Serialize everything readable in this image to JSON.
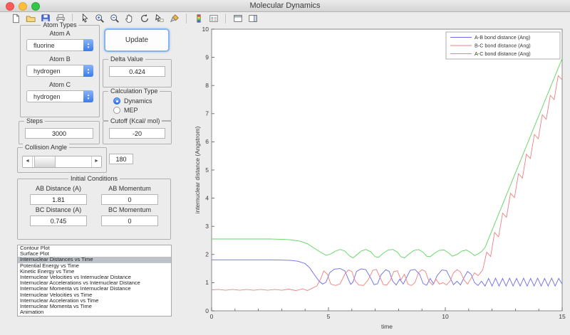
{
  "window": {
    "title": "Molecular Dynamics"
  },
  "colors": {
    "accent": "#3a7bf0",
    "selection": "#bdc3c9",
    "series_blue": "#6b6bee",
    "series_red": "#ef8080",
    "series_green": "#5fd45f"
  },
  "toolbar": {
    "groups": [
      [
        "new-figure",
        "open-file",
        "save-figure",
        "print-figure"
      ],
      [
        "edit-plot",
        "zoom-in",
        "zoom-out",
        "pan",
        "rotate-3d",
        "data-cursor",
        "brush-data"
      ],
      [
        "insert-colorbar",
        "insert-legend"
      ],
      [
        "hide-plot-tools",
        "show-plot-tools"
      ]
    ]
  },
  "panel": {
    "atom_types": {
      "title": "Atom Types",
      "atoms": [
        {
          "label": "Atom A",
          "value": "fluorine"
        },
        {
          "label": "Atom B",
          "value": "hydrogen"
        },
        {
          "label": "Atom C",
          "value": "hydrogen"
        }
      ]
    },
    "update_label": "Update",
    "delta": {
      "title": "Delta Value",
      "value": "0.424"
    },
    "calc": {
      "title": "Calculation Type",
      "options": [
        "Dynamics",
        "MEP"
      ],
      "selected": "Dynamics"
    },
    "steps": {
      "title": "Steps",
      "value": "3000"
    },
    "cutoff": {
      "title": "Cutoff (Kcal/ mol)",
      "value": "-20"
    },
    "collision": {
      "title": "Collision Angle",
      "value": "180"
    },
    "initial": {
      "title": "Initial Conditions",
      "fields": [
        {
          "label": "AB Distance (A)",
          "value": "1.81"
        },
        {
          "label": "AB Momentum",
          "value": "0"
        },
        {
          "label": "BC Distance (A)",
          "value": "0.745"
        },
        {
          "label": "BC Momentum",
          "value": "0"
        }
      ]
    },
    "plot_list": {
      "selected_index": 2,
      "items": [
        "Contour Plot",
        "Surface Plot",
        "Internuclear Distances vs Time",
        "Potential Energy vs Time",
        "Kinetic Energy vs Time",
        "Internuclear Velocities vs Internuclear Distance",
        "Internuclear Accelerations vs Internuclear Distance",
        "Internuclear Momenta vs Internuclear Distance",
        "Internuclear Velocities vs Time",
        "Internuclear Acceleration vs Time",
        "Internuclear Momenta vs Time",
        "Animation"
      ]
    }
  },
  "chart_data": {
    "type": "line",
    "title": "",
    "xlabel": "time",
    "ylabel": "internuclear distance (Angstrom)",
    "xlim": [
      0,
      15
    ],
    "ylim": [
      0,
      10
    ],
    "xticks": [
      0,
      5,
      10,
      15
    ],
    "yticks": [
      0,
      1,
      2,
      3,
      4,
      5,
      6,
      7,
      8,
      9,
      10
    ],
    "grid": false,
    "legend_position": "top-right",
    "series": [
      {
        "name": "A-B bond distance (Ang)",
        "color": "#6b6bee",
        "points": [
          [
            0,
            1.81
          ],
          [
            0.5,
            1.81
          ],
          [
            1,
            1.81
          ],
          [
            1.5,
            1.81
          ],
          [
            2,
            1.81
          ],
          [
            2.5,
            1.81
          ],
          [
            3,
            1.8
          ],
          [
            3.4,
            1.79
          ],
          [
            3.7,
            1.76
          ],
          [
            4,
            1.68
          ],
          [
            4.2,
            1.52
          ],
          [
            4.4,
            1.28
          ],
          [
            4.6,
            1.05
          ],
          [
            4.75,
            0.95
          ],
          [
            4.9,
            1.02
          ],
          [
            5.05,
            1.35
          ],
          [
            5.25,
            1.48
          ],
          [
            5.5,
            1.5
          ],
          [
            5.7,
            1.42
          ],
          [
            5.85,
            1.12
          ],
          [
            5.95,
            0.94
          ],
          [
            6.05,
            1.02
          ],
          [
            6.2,
            1.4
          ],
          [
            6.4,
            1.49
          ],
          [
            6.6,
            1.46
          ],
          [
            6.8,
            1.18
          ],
          [
            6.95,
            0.93
          ],
          [
            7.1,
            0.96
          ],
          [
            7.25,
            1.28
          ],
          [
            7.45,
            1.46
          ],
          [
            7.6,
            1.4
          ],
          [
            7.75,
            1.05
          ],
          [
            7.9,
            0.92
          ],
          [
            8.05,
            1.12
          ],
          [
            8.2,
            0.95
          ],
          [
            8.35,
            1.2
          ],
          [
            8.5,
            1.44
          ],
          [
            8.7,
            1.47
          ],
          [
            8.9,
            1.3
          ],
          [
            9.05,
            0.97
          ],
          [
            9.2,
            0.91
          ],
          [
            9.35,
            1.15
          ],
          [
            9.5,
            0.96
          ],
          [
            9.65,
            1.25
          ],
          [
            9.85,
            1.45
          ],
          [
            10.05,
            1.43
          ],
          [
            10.2,
            1.18
          ],
          [
            10.35,
            0.93
          ],
          [
            10.5,
            1.05
          ],
          [
            10.65,
            0.92
          ],
          [
            10.8,
            1.18
          ],
          [
            10.95,
            1.4
          ],
          [
            11.1,
            1.3
          ],
          [
            11.25,
            1
          ],
          [
            11.4,
            0.9
          ],
          [
            11.55,
            1.05
          ],
          [
            11.7,
            0.88
          ],
          [
            11.85,
            1.15
          ],
          [
            12,
            0.88
          ],
          [
            12.15,
            1.16
          ],
          [
            12.3,
            0.88
          ],
          [
            12.45,
            1.15
          ],
          [
            12.6,
            0.88
          ],
          [
            12.75,
            1.16
          ],
          [
            12.9,
            0.88
          ],
          [
            13.05,
            1.15
          ],
          [
            13.2,
            0.88
          ],
          [
            13.35,
            1.16
          ],
          [
            13.5,
            0.88
          ],
          [
            13.65,
            1.15
          ],
          [
            13.8,
            0.88
          ],
          [
            13.95,
            1.16
          ],
          [
            14.1,
            0.88
          ],
          [
            14.25,
            1.15
          ],
          [
            14.4,
            0.88
          ],
          [
            14.55,
            1.16
          ],
          [
            14.7,
            0.88
          ],
          [
            14.85,
            1.15
          ],
          [
            15,
            0.95
          ]
        ]
      },
      {
        "name": "B-C bond distance (Ang)",
        "color": "#ef8080",
        "points": [
          [
            0,
            0.745
          ],
          [
            0.3,
            0.76
          ],
          [
            0.6,
            0.73
          ],
          [
            0.9,
            0.76
          ],
          [
            1.2,
            0.73
          ],
          [
            1.5,
            0.76
          ],
          [
            1.8,
            0.73
          ],
          [
            2.1,
            0.76
          ],
          [
            2.4,
            0.73
          ],
          [
            2.7,
            0.76
          ],
          [
            3,
            0.73
          ],
          [
            3.3,
            0.77
          ],
          [
            3.6,
            0.72
          ],
          [
            3.9,
            0.78
          ],
          [
            4.1,
            0.72
          ],
          [
            4.3,
            0.8
          ],
          [
            4.5,
            0.88
          ],
          [
            4.65,
            1.1
          ],
          [
            4.8,
            1.42
          ],
          [
            4.95,
            1.3
          ],
          [
            5.1,
            0.95
          ],
          [
            5.3,
            0.9
          ],
          [
            5.5,
            0.96
          ],
          [
            5.7,
            1.3
          ],
          [
            5.85,
            1.45
          ],
          [
            6,
            1.4
          ],
          [
            6.15,
            1.05
          ],
          [
            6.3,
            0.92
          ],
          [
            6.5,
            0.9
          ],
          [
            6.7,
            1.1
          ],
          [
            6.9,
            1.44
          ],
          [
            7.05,
            1.47
          ],
          [
            7.2,
            1.2
          ],
          [
            7.35,
            0.93
          ],
          [
            7.5,
            0.92
          ],
          [
            7.65,
            1.08
          ],
          [
            7.8,
            1.4
          ],
          [
            7.95,
            1.42
          ],
          [
            8.1,
            1.1
          ],
          [
            8.25,
            1.3
          ],
          [
            8.4,
            0.95
          ],
          [
            8.55,
            0.9
          ],
          [
            8.7,
            1
          ],
          [
            8.85,
            1.35
          ],
          [
            9,
            1.46
          ],
          [
            9.15,
            1.4
          ],
          [
            9.3,
            1.05
          ],
          [
            9.45,
            0.92
          ],
          [
            9.6,
            1.12
          ],
          [
            9.75,
            0.95
          ],
          [
            9.9,
            1
          ],
          [
            10.05,
            0.92
          ],
          [
            10.2,
            1.05
          ],
          [
            10.35,
            1.35
          ],
          [
            10.5,
            1.46
          ],
          [
            10.65,
            1.38
          ],
          [
            10.8,
            1.1
          ],
          [
            10.95,
            0.95
          ],
          [
            11.1,
            1.15
          ],
          [
            11.25,
            1.35
          ],
          [
            11.4,
            1.25
          ],
          [
            11.6,
            1.45
          ],
          [
            11.77,
            2.08
          ],
          [
            11.94,
            1.93
          ],
          [
            12.11,
            2.78
          ],
          [
            12.28,
            2.63
          ],
          [
            12.45,
            3.47
          ],
          [
            12.62,
            3.32
          ],
          [
            12.79,
            4.17
          ],
          [
            12.96,
            4.02
          ],
          [
            13.13,
            4.87
          ],
          [
            13.3,
            4.71
          ],
          [
            13.47,
            5.56
          ],
          [
            13.64,
            5.41
          ],
          [
            13.81,
            6.26
          ],
          [
            13.98,
            6.11
          ],
          [
            14.15,
            6.96
          ],
          [
            14.32,
            6.8
          ],
          [
            14.49,
            7.65
          ],
          [
            14.66,
            7.5
          ],
          [
            14.83,
            8.35
          ],
          [
            15,
            8.2
          ]
        ]
      },
      {
        "name": "A-C bond distance (Ang)",
        "color": "#5fd45f",
        "points": [
          [
            0,
            2.55
          ],
          [
            0.5,
            2.55
          ],
          [
            1,
            2.55
          ],
          [
            1.5,
            2.55
          ],
          [
            2,
            2.55
          ],
          [
            2.5,
            2.55
          ],
          [
            3,
            2.54
          ],
          [
            3.4,
            2.52
          ],
          [
            3.8,
            2.47
          ],
          [
            4.1,
            2.38
          ],
          [
            4.4,
            2.22
          ],
          [
            4.7,
            2.06
          ],
          [
            4.9,
            1.97
          ],
          [
            5.1,
            2.02
          ],
          [
            5.3,
            2.12
          ],
          [
            5.5,
            2.18
          ],
          [
            5.7,
            2.12
          ],
          [
            5.9,
            1.95
          ],
          [
            6.05,
            1.88
          ],
          [
            6.2,
            1.98
          ],
          [
            6.4,
            2.12
          ],
          [
            6.6,
            2.18
          ],
          [
            6.8,
            2.1
          ],
          [
            7,
            1.92
          ],
          [
            7.15,
            1.9
          ],
          [
            7.35,
            2.05
          ],
          [
            7.55,
            2.16
          ],
          [
            7.75,
            2.18
          ],
          [
            7.95,
            2.08
          ],
          [
            8.1,
            1.92
          ],
          [
            8.25,
            1.88
          ],
          [
            8.45,
            2.02
          ],
          [
            8.65,
            2.14
          ],
          [
            8.85,
            2.18
          ],
          [
            9.05,
            2.08
          ],
          [
            9.2,
            1.94
          ],
          [
            9.35,
            1.92
          ],
          [
            9.55,
            2.05
          ],
          [
            9.75,
            2.15
          ],
          [
            9.95,
            2.16
          ],
          [
            10.15,
            2.05
          ],
          [
            10.3,
            1.94
          ],
          [
            10.5,
            2
          ],
          [
            10.7,
            2.12
          ],
          [
            10.9,
            2.16
          ],
          [
            11.1,
            2.06
          ],
          [
            11.25,
            1.96
          ],
          [
            11.4,
            2.02
          ],
          [
            11.55,
            2.1
          ],
          [
            11.7,
            2.25
          ],
          [
            12,
            2.86
          ],
          [
            12.3,
            3.47
          ],
          [
            12.6,
            4.08
          ],
          [
            12.9,
            4.69
          ],
          [
            13.2,
            5.3
          ],
          [
            13.5,
            5.91
          ],
          [
            13.8,
            6.52
          ],
          [
            14.1,
            7.13
          ],
          [
            14.4,
            7.74
          ],
          [
            14.7,
            8.35
          ],
          [
            15,
            8.96
          ]
        ]
      }
    ]
  }
}
